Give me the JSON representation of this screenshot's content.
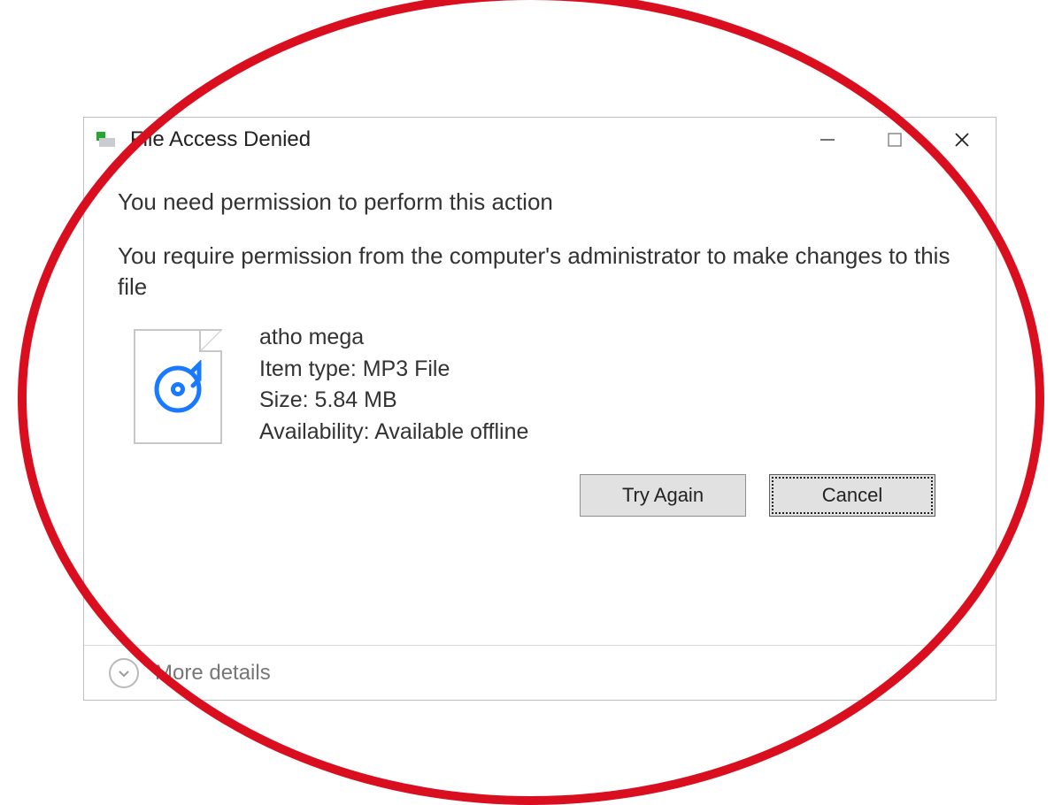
{
  "dialog": {
    "title": "File Access Denied",
    "heading": "You need permission to perform this action",
    "description": "You require permission from the computer's administrator to make changes to this file",
    "file": {
      "name": "atho mega",
      "type_label": "Item type:",
      "type_value": "MP3 File",
      "size_label": "Size:",
      "size_value": "5.84 MB",
      "availability_label": "Availability:",
      "availability_value": "Available offline"
    },
    "buttons": {
      "try_again": "Try Again",
      "cancel": "Cancel"
    },
    "footer": {
      "more_details": "More details"
    }
  }
}
